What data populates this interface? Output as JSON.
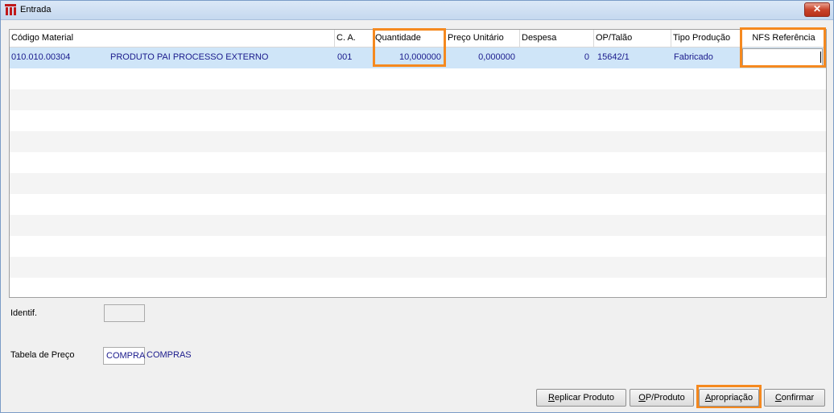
{
  "window": {
    "title": "Entrada",
    "close_label": "✕"
  },
  "grid": {
    "columns": [
      "Código Material",
      "C. A.",
      "Quantidade",
      "Preço Unitário",
      "Despesa",
      "OP/Talão",
      "Tipo Produção",
      "NFS Referência"
    ],
    "rows": [
      {
        "codigo": "010.010.00304",
        "descricao": "PRODUTO PAI PROCESSO EXTERNO",
        "ca": "001",
        "quantidade": "10,000000",
        "preco": "0,000000",
        "despesa": "0",
        "op": "15642/1",
        "tipo": "Fabricado",
        "nfs": ""
      }
    ]
  },
  "form": {
    "identif_label": "Identif.",
    "identif_value": "",
    "tabela_label": "Tabela de Preço",
    "tabela_code": "COMPRA",
    "tabela_desc": "COMPRAS"
  },
  "buttons": {
    "replicar": {
      "mnemonic": "R",
      "rest": "eplicar Produto"
    },
    "op_produto": {
      "mnemonic": "O",
      "rest": "P/Produto"
    },
    "apropriacao": {
      "mnemonic": "A",
      "rest": "propriação"
    },
    "confirmar": {
      "mnemonic": "C",
      "rest": "onfirmar"
    }
  },
  "colors": {
    "highlight": "#f5891f",
    "selection": "#cfe5f8",
    "value_text": "#1a1a8c"
  }
}
